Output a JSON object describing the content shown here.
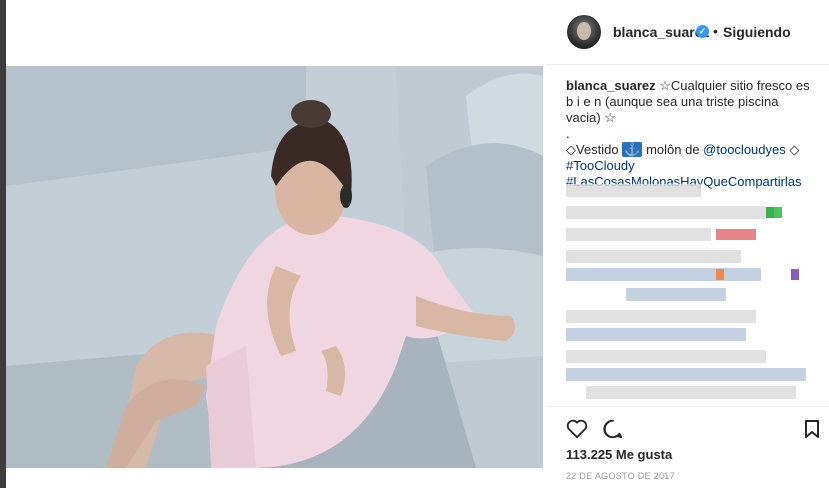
{
  "post": {
    "username": "blanca_suarez",
    "verified_glyph": "✓",
    "dot": "•",
    "follow_label": "Siguiendo",
    "caption": {
      "username": "blanca_suarez",
      "line1": " ☆Cualquier sitio fresco es b i e n (aunque sea una triste piscina vacia) ☆",
      "line2": ".",
      "line3_prefix": "◇Vestido ",
      "anchor_emoji": "⚓",
      "line3_mid": " molôn de ",
      "mention": "@toocloudyes",
      "line3_suffix": " ◇",
      "hashtag1": "#TooCloudy",
      "hashtag2": "#LasCosasMolonasHayQueCompartirlas"
    },
    "likes": "113.225 Me gusta",
    "date": "22 DE AGOSTO DE 2017",
    "icons": {
      "avatar": "avatar",
      "like": "heart-icon",
      "comment": "comment-icon",
      "save": "bookmark-icon"
    },
    "colors": {
      "link": "#003569",
      "verified": "#3897f0",
      "text": "#262626"
    }
  }
}
